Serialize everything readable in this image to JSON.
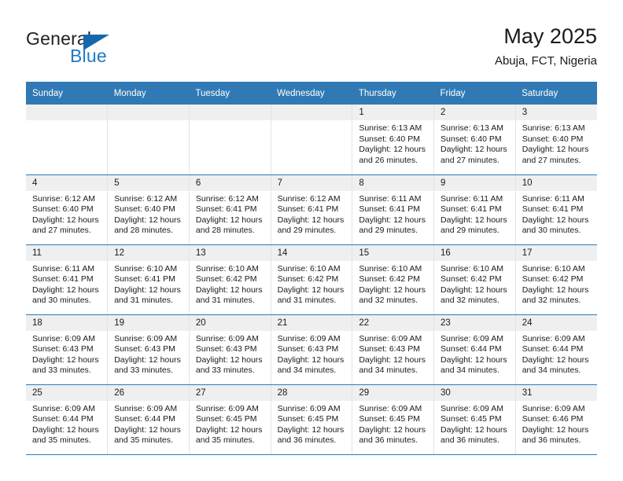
{
  "logo": {
    "word_top": "General",
    "word_bottom": "Blue",
    "triangle_color": "#1668ad",
    "blue_color": "#1f7ac4"
  },
  "header": {
    "title": "May 2025",
    "subtitle": "Abuja, FCT, Nigeria"
  },
  "theme": {
    "header_blue": "#3079b5",
    "daynum_band": "#efefef",
    "cell_border": "#e4e4e4"
  },
  "weekday_headers": [
    "Sunday",
    "Monday",
    "Tuesday",
    "Wednesday",
    "Thursday",
    "Friday",
    "Saturday"
  ],
  "weeks": [
    [
      {
        "day": "",
        "lines": []
      },
      {
        "day": "",
        "lines": []
      },
      {
        "day": "",
        "lines": []
      },
      {
        "day": "",
        "lines": []
      },
      {
        "day": "1",
        "lines": [
          "Sunrise: 6:13 AM",
          "Sunset: 6:40 PM",
          "Daylight: 12 hours",
          "and 26 minutes."
        ]
      },
      {
        "day": "2",
        "lines": [
          "Sunrise: 6:13 AM",
          "Sunset: 6:40 PM",
          "Daylight: 12 hours",
          "and 27 minutes."
        ]
      },
      {
        "day": "3",
        "lines": [
          "Sunrise: 6:13 AM",
          "Sunset: 6:40 PM",
          "Daylight: 12 hours",
          "and 27 minutes."
        ]
      }
    ],
    [
      {
        "day": "4",
        "lines": [
          "Sunrise: 6:12 AM",
          "Sunset: 6:40 PM",
          "Daylight: 12 hours",
          "and 27 minutes."
        ]
      },
      {
        "day": "5",
        "lines": [
          "Sunrise: 6:12 AM",
          "Sunset: 6:40 PM",
          "Daylight: 12 hours",
          "and 28 minutes."
        ]
      },
      {
        "day": "6",
        "lines": [
          "Sunrise: 6:12 AM",
          "Sunset: 6:41 PM",
          "Daylight: 12 hours",
          "and 28 minutes."
        ]
      },
      {
        "day": "7",
        "lines": [
          "Sunrise: 6:12 AM",
          "Sunset: 6:41 PM",
          "Daylight: 12 hours",
          "and 29 minutes."
        ]
      },
      {
        "day": "8",
        "lines": [
          "Sunrise: 6:11 AM",
          "Sunset: 6:41 PM",
          "Daylight: 12 hours",
          "and 29 minutes."
        ]
      },
      {
        "day": "9",
        "lines": [
          "Sunrise: 6:11 AM",
          "Sunset: 6:41 PM",
          "Daylight: 12 hours",
          "and 29 minutes."
        ]
      },
      {
        "day": "10",
        "lines": [
          "Sunrise: 6:11 AM",
          "Sunset: 6:41 PM",
          "Daylight: 12 hours",
          "and 30 minutes."
        ]
      }
    ],
    [
      {
        "day": "11",
        "lines": [
          "Sunrise: 6:11 AM",
          "Sunset: 6:41 PM",
          "Daylight: 12 hours",
          "and 30 minutes."
        ]
      },
      {
        "day": "12",
        "lines": [
          "Sunrise: 6:10 AM",
          "Sunset: 6:41 PM",
          "Daylight: 12 hours",
          "and 31 minutes."
        ]
      },
      {
        "day": "13",
        "lines": [
          "Sunrise: 6:10 AM",
          "Sunset: 6:42 PM",
          "Daylight: 12 hours",
          "and 31 minutes."
        ]
      },
      {
        "day": "14",
        "lines": [
          "Sunrise: 6:10 AM",
          "Sunset: 6:42 PM",
          "Daylight: 12 hours",
          "and 31 minutes."
        ]
      },
      {
        "day": "15",
        "lines": [
          "Sunrise: 6:10 AM",
          "Sunset: 6:42 PM",
          "Daylight: 12 hours",
          "and 32 minutes."
        ]
      },
      {
        "day": "16",
        "lines": [
          "Sunrise: 6:10 AM",
          "Sunset: 6:42 PM",
          "Daylight: 12 hours",
          "and 32 minutes."
        ]
      },
      {
        "day": "17",
        "lines": [
          "Sunrise: 6:10 AM",
          "Sunset: 6:42 PM",
          "Daylight: 12 hours",
          "and 32 minutes."
        ]
      }
    ],
    [
      {
        "day": "18",
        "lines": [
          "Sunrise: 6:09 AM",
          "Sunset: 6:43 PM",
          "Daylight: 12 hours",
          "and 33 minutes."
        ]
      },
      {
        "day": "19",
        "lines": [
          "Sunrise: 6:09 AM",
          "Sunset: 6:43 PM",
          "Daylight: 12 hours",
          "and 33 minutes."
        ]
      },
      {
        "day": "20",
        "lines": [
          "Sunrise: 6:09 AM",
          "Sunset: 6:43 PM",
          "Daylight: 12 hours",
          "and 33 minutes."
        ]
      },
      {
        "day": "21",
        "lines": [
          "Sunrise: 6:09 AM",
          "Sunset: 6:43 PM",
          "Daylight: 12 hours",
          "and 34 minutes."
        ]
      },
      {
        "day": "22",
        "lines": [
          "Sunrise: 6:09 AM",
          "Sunset: 6:43 PM",
          "Daylight: 12 hours",
          "and 34 minutes."
        ]
      },
      {
        "day": "23",
        "lines": [
          "Sunrise: 6:09 AM",
          "Sunset: 6:44 PM",
          "Daylight: 12 hours",
          "and 34 minutes."
        ]
      },
      {
        "day": "24",
        "lines": [
          "Sunrise: 6:09 AM",
          "Sunset: 6:44 PM",
          "Daylight: 12 hours",
          "and 34 minutes."
        ]
      }
    ],
    [
      {
        "day": "25",
        "lines": [
          "Sunrise: 6:09 AM",
          "Sunset: 6:44 PM",
          "Daylight: 12 hours",
          "and 35 minutes."
        ]
      },
      {
        "day": "26",
        "lines": [
          "Sunrise: 6:09 AM",
          "Sunset: 6:44 PM",
          "Daylight: 12 hours",
          "and 35 minutes."
        ]
      },
      {
        "day": "27",
        "lines": [
          "Sunrise: 6:09 AM",
          "Sunset: 6:45 PM",
          "Daylight: 12 hours",
          "and 35 minutes."
        ]
      },
      {
        "day": "28",
        "lines": [
          "Sunrise: 6:09 AM",
          "Sunset: 6:45 PM",
          "Daylight: 12 hours",
          "and 36 minutes."
        ]
      },
      {
        "day": "29",
        "lines": [
          "Sunrise: 6:09 AM",
          "Sunset: 6:45 PM",
          "Daylight: 12 hours",
          "and 36 minutes."
        ]
      },
      {
        "day": "30",
        "lines": [
          "Sunrise: 6:09 AM",
          "Sunset: 6:45 PM",
          "Daylight: 12 hours",
          "and 36 minutes."
        ]
      },
      {
        "day": "31",
        "lines": [
          "Sunrise: 6:09 AM",
          "Sunset: 6:46 PM",
          "Daylight: 12 hours",
          "and 36 minutes."
        ]
      }
    ]
  ]
}
